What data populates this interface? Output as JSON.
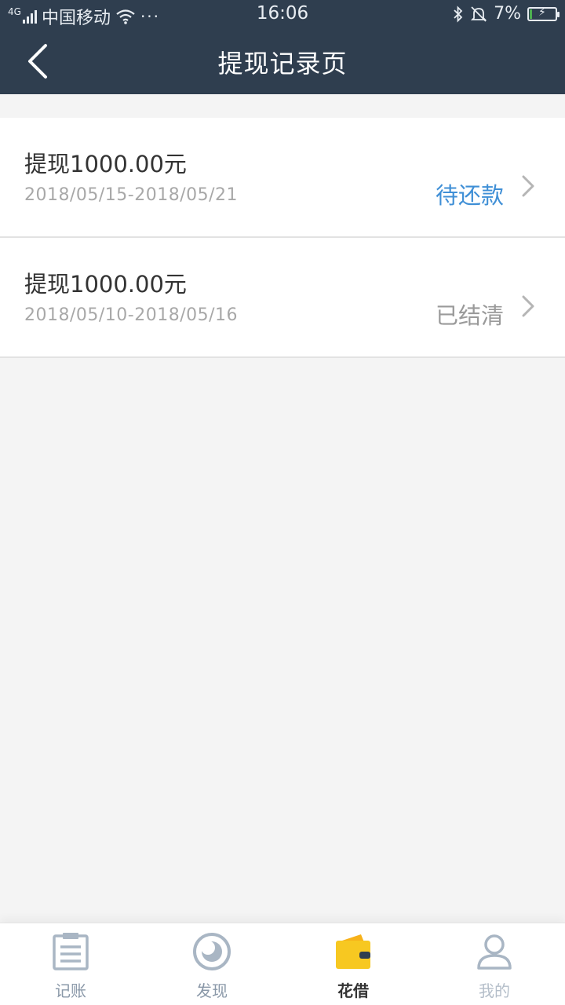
{
  "status_bar": {
    "network": "4G",
    "carrier": "中国移动",
    "more": "···",
    "time": "16:06",
    "battery": "7%",
    "battery_level": 0.07,
    "icons": [
      "signal-icon",
      "wifi-icon",
      "bluetooth-icon",
      "alarm-off-icon",
      "battery-icon"
    ]
  },
  "header": {
    "title": "提现记录页",
    "back_icon": "back-arrow-icon"
  },
  "records": [
    {
      "title": "提现1000.00元",
      "date_range": "2018/05/15-2018/05/21",
      "status": "待还款",
      "status_color": "#3f8fd6"
    },
    {
      "title": "提现1000.00元",
      "date_range": "2018/05/10-2018/05/16",
      "status": "已结清",
      "status_color": "#9a9a9a"
    }
  ],
  "tabbar": {
    "active_color": "#f7c821",
    "inactive_color": "#a9b6c4",
    "items": [
      {
        "label": "记账",
        "icon": "notebook-icon"
      },
      {
        "label": "发现",
        "icon": "discover-icon"
      },
      {
        "label": "花借",
        "icon": "wallet-icon"
      },
      {
        "label": "我的",
        "icon": "user-icon"
      }
    ]
  },
  "colors": {
    "header_bg": "#2f3e4f",
    "page_bg": "#f4f4f4"
  }
}
